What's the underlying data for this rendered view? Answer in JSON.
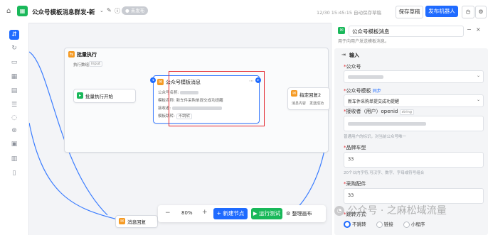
{
  "header": {
    "title": "公众号模板消息群发-新",
    "status_badge": "未发布",
    "save_info": "12/30 15:45:15 自动保存草稿",
    "save_button": "保存草稿",
    "publish_button": "发布机器人"
  },
  "canvas": {
    "batch_node": {
      "title": "批量执行",
      "subtitle_label": "执行数组",
      "subtitle_tag": "input"
    },
    "batch_start_node": {
      "title": "批量执行开始"
    },
    "template_node": {
      "title": "公众号模板消息",
      "rows": [
        {
          "label": "公众号名称:",
          "value": ""
        },
        {
          "label": "模板名称:",
          "value": "新车件采购单提交成功提醒"
        },
        {
          "label": "接收者:",
          "value": ""
        },
        {
          "label": "模板跳转:",
          "value": "不跳转"
        }
      ]
    },
    "reply_node": {
      "title": "指定回复2",
      "row_label": "消息内容",
      "row_value": "发送成功"
    },
    "bottom_node": {
      "title": "消息回复"
    }
  },
  "toolbar": {
    "zoom": "80%",
    "add_node": "+ 新建节点",
    "test_run": "▶ 运行测试",
    "organize": "整理画布"
  },
  "panel": {
    "title": "公众号模板消息",
    "description": "用于向用户发送模板消息。",
    "section_input": "输入",
    "account_label": "公众号",
    "template_label": "公众号模板",
    "template_sync": "同步",
    "template_value": "新车件采购单提交成功提醒",
    "receiver_label": "接收者（用户）openid",
    "receiver_tag": "string",
    "receiver_hint": "普通用户的标识，对当前公众号唯一",
    "brand_label": "品牌车型",
    "brand_value": "33",
    "brand_hint": "20个以内字符,可汉字、数字、字母或符号组合",
    "purchase_label": "采购配件",
    "purchase_value": "33",
    "jump_label": "跳转方式",
    "jump_options": [
      "不跳转",
      "链接",
      "小程序"
    ],
    "jump_selected": "不跳转"
  },
  "watermark": "公众号 · 之麻松域流量"
}
